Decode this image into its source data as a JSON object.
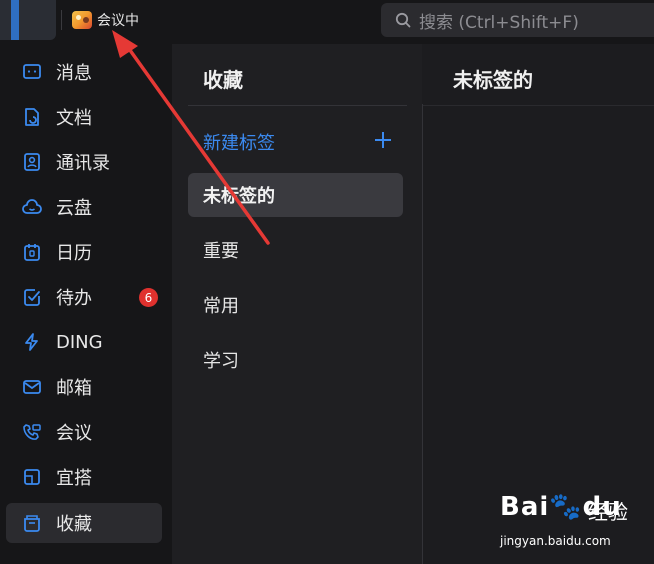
{
  "topbar": {
    "meeting_label": "会议中",
    "search_placeholder": "搜索 (Ctrl+Shift+F)"
  },
  "sidebar": {
    "items": [
      {
        "label": "消息",
        "icon": "message-icon"
      },
      {
        "label": "文档",
        "icon": "document-icon"
      },
      {
        "label": "通讯录",
        "icon": "contacts-icon"
      },
      {
        "label": "云盘",
        "icon": "cloud-icon"
      },
      {
        "label": "日历",
        "icon": "calendar-icon"
      },
      {
        "label": "待办",
        "icon": "todo-icon",
        "badge": "6"
      },
      {
        "label": "DING",
        "icon": "lightning-icon"
      },
      {
        "label": "邮箱",
        "icon": "mail-icon"
      },
      {
        "label": "会议",
        "icon": "meeting-phone-icon"
      },
      {
        "label": "宜搭",
        "icon": "yida-icon"
      },
      {
        "label": "收藏",
        "icon": "favorites-icon",
        "active": true
      }
    ]
  },
  "middle": {
    "title": "收藏",
    "new_tag_label": "新建标签",
    "tags": [
      {
        "label": "未标签的",
        "active": true
      },
      {
        "label": "重要"
      },
      {
        "label": "常用"
      },
      {
        "label": "学习"
      }
    ]
  },
  "right": {
    "title": "未标签的"
  },
  "watermark": {
    "logo": "Bai🐾du",
    "cn": "经验",
    "url": "jingyan.baidu.com"
  },
  "colors": {
    "accent": "#3b8af0",
    "badge": "#e0312e",
    "annotation_arrow": "#e53935"
  }
}
